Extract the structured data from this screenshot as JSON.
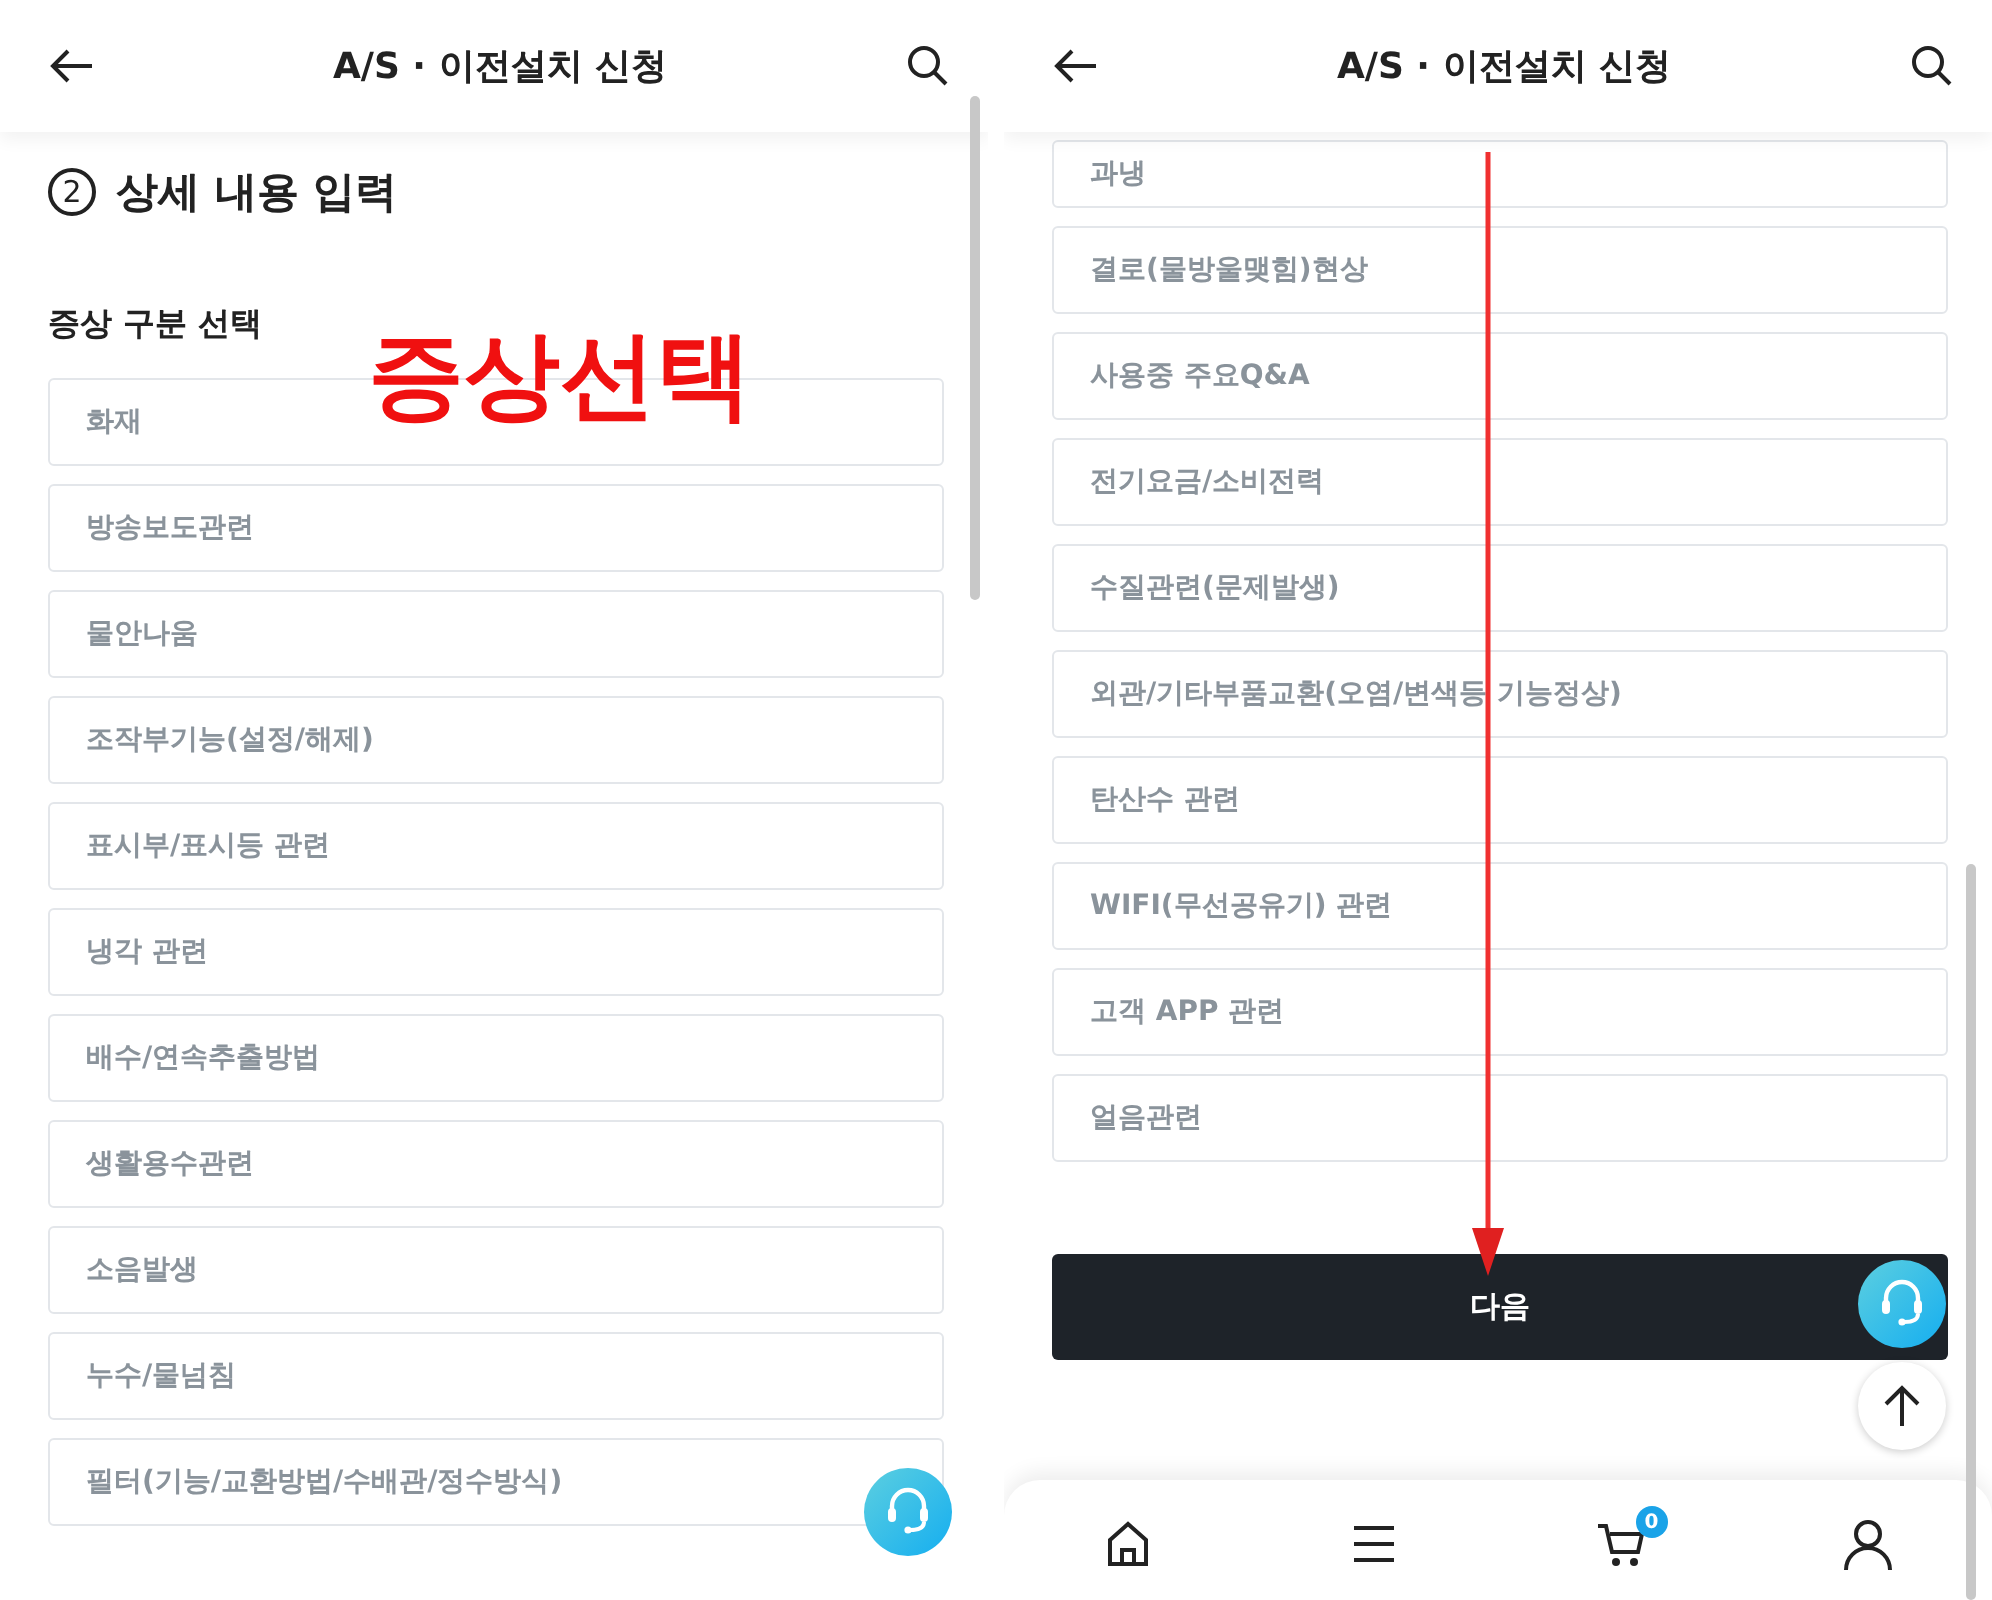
{
  "panels": [
    {
      "header": {
        "title": "A/S · 이전설치 신청"
      },
      "section": {
        "step": "2",
        "title": "상세 내용 입력"
      },
      "subtitle": "증상 구분 선택",
      "items": [
        "화재",
        "방송보도관련",
        "물안나움",
        "조작부기능(설정/해제)",
        "표시부/표시등 관련",
        "냉각 관련",
        "배수/연속추출방법",
        "생활용수관련",
        "소음발생",
        "누수/물넘침",
        "필터(기능/교환방법/수배관/정수방식)"
      ],
      "annotation": {
        "text": "증상선택"
      }
    },
    {
      "header": {
        "title": "A/S · 이전설치 신청"
      },
      "items": [
        "과냉",
        "결로(물방울맺힘)현상",
        "사용중 주요Q&A",
        "전기요금/소비전력",
        "수질관련(문제발생)",
        "외관/기타부품교환(오염/변색등 기능정상)",
        "탄산수 관련",
        "WIFI(무선공유기) 관련",
        "고객 APP 관련",
        "얼음관련"
      ],
      "next_button": "다음",
      "bottom_nav": {
        "cart_count": "0"
      }
    }
  ]
}
